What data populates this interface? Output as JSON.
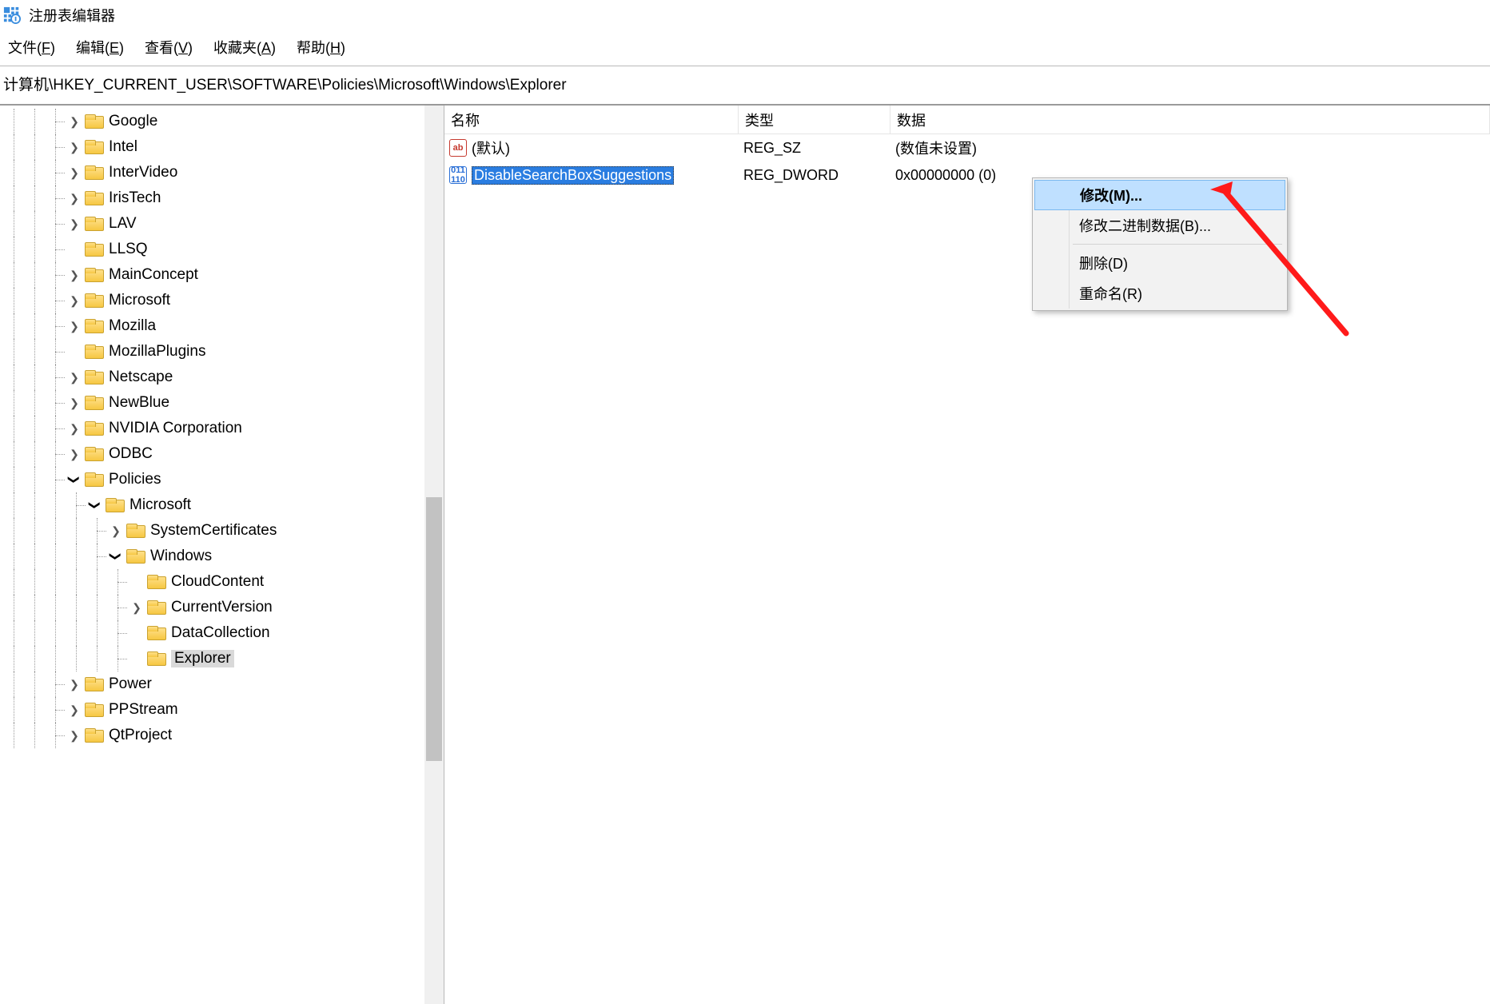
{
  "app": {
    "title": "注册表编辑器"
  },
  "menu": {
    "file": "文件(F)",
    "edit": "编辑(E)",
    "view": "查看(V)",
    "favorites": "收藏夹(A)",
    "help": "帮助(H)"
  },
  "address": "计算机\\HKEY_CURRENT_USER\\SOFTWARE\\Policies\\Microsoft\\Windows\\Explorer",
  "tree": {
    "google": "Google",
    "intel": "Intel",
    "intervideo": "InterVideo",
    "iristech": "IrisTech",
    "lav": "LAV",
    "llsq": "LLSQ",
    "mainconcept": "MainConcept",
    "microsoft": "Microsoft",
    "mozilla": "Mozilla",
    "mozillaplugins": "MozillaPlugins",
    "netscape": "Netscape",
    "newblue": "NewBlue",
    "nvidia": "NVIDIA Corporation",
    "odbc": "ODBC",
    "policies": "Policies",
    "policies_microsoft": "Microsoft",
    "systemcertificates": "SystemCertificates",
    "windows": "Windows",
    "cloudcontent": "CloudContent",
    "currentversion": "CurrentVersion",
    "datacollection": "DataCollection",
    "explorer": "Explorer",
    "power": "Power",
    "ppstream": "PPStream",
    "qtproject": "QtProject"
  },
  "list": {
    "headers": {
      "name": "名称",
      "type": "类型",
      "data": "数据"
    },
    "rows": [
      {
        "name": "(默认)",
        "type": "REG_SZ",
        "data": "(数值未设置)",
        "icon": "sz"
      },
      {
        "name": "DisableSearchBoxSuggestions",
        "type": "REG_DWORD",
        "data": "0x00000000 (0)",
        "icon": "dw"
      }
    ]
  },
  "context_menu": {
    "modify": "修改(M)...",
    "modify_binary": "修改二进制数据(B)...",
    "delete": "删除(D)",
    "rename": "重命名(R)"
  }
}
